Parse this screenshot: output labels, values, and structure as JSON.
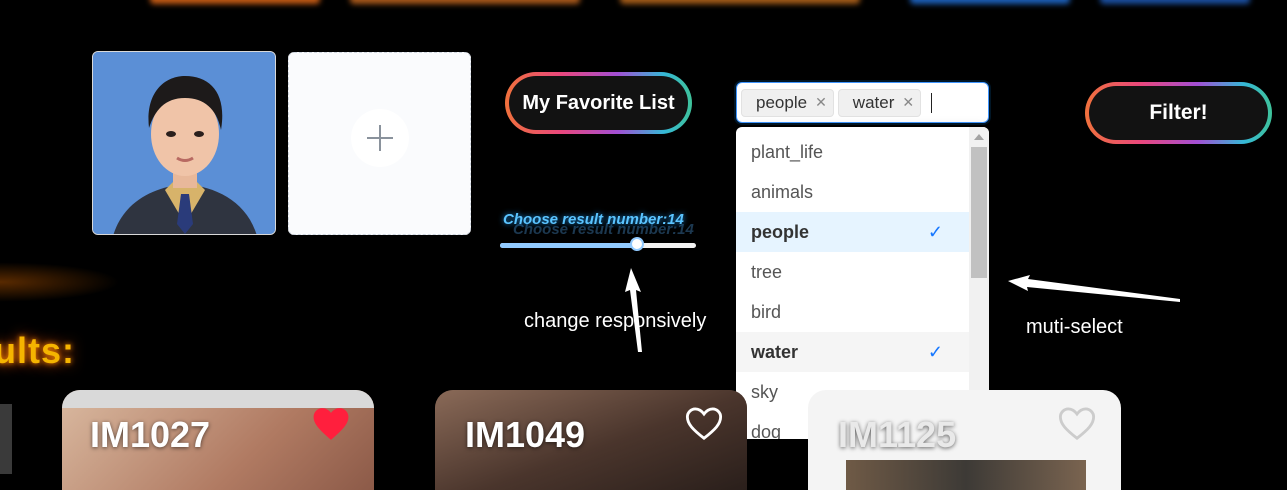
{
  "upload": {
    "photo_alt": "",
    "add_icon": "plus-icon"
  },
  "buttons": {
    "favorite": "My Favorite List",
    "filter": "Filter!"
  },
  "slider": {
    "label": "Choose result number:14",
    "value": 14,
    "min": 0,
    "max": 20
  },
  "select": {
    "tags": [
      "people",
      "water"
    ],
    "options": [
      {
        "label": "plant_life",
        "selected": false
      },
      {
        "label": "animals",
        "selected": false
      },
      {
        "label": "people",
        "selected": true
      },
      {
        "label": "tree",
        "selected": false
      },
      {
        "label": "bird",
        "selected": false
      },
      {
        "label": "water",
        "selected": true
      },
      {
        "label": "sky",
        "selected": false
      },
      {
        "label": "dog",
        "selected": false
      }
    ]
  },
  "annotations": {
    "slider_note": "change responsively",
    "select_note": "muti-select"
  },
  "results": {
    "title": "ults:",
    "cards": [
      {
        "id": "IM1027",
        "favorited": true
      },
      {
        "id": "IM1049",
        "favorited": false
      },
      {
        "id": "IM1125",
        "favorited": false
      }
    ]
  },
  "colors": {
    "accent_blue": "#4096ff",
    "slider_blue": "#91caff",
    "heart_red": "#ff1f3d",
    "results_title": "#f5b400"
  }
}
